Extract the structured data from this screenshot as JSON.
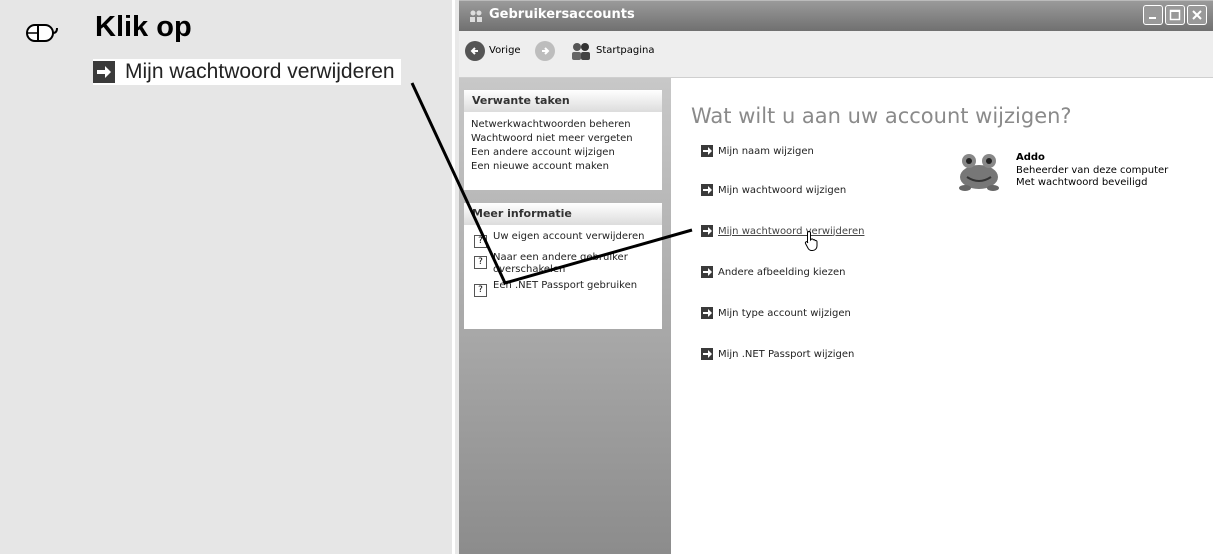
{
  "instruction": {
    "heading": "Klik op",
    "link_label": "Mijn wachtwoord verwijderen"
  },
  "window": {
    "title": "Gebruikersaccounts",
    "nav": {
      "back_label": "Vorige",
      "home_label": "Startpagina"
    }
  },
  "sidebar": {
    "related": {
      "heading": "Verwante taken",
      "items": [
        "Netwerkwachtwoorden beheren",
        "Wachtwoord niet meer vergeten",
        "Een andere account wijzigen",
        "Een nieuwe account maken"
      ]
    },
    "info": {
      "heading": "Meer informatie",
      "items": [
        "Uw eigen account verwijderen",
        "Naar een andere gebruiker overschakelen",
        "Een .NET Passport gebruiken"
      ]
    }
  },
  "main": {
    "title": "Wat wilt u aan uw account wijzigen?",
    "actions": [
      "Mijn naam wijzigen",
      "Mijn wachtwoord wijzigen",
      "Mijn wachtwoord verwijderen",
      "Andere afbeelding kiezen",
      "Mijn type account wijzigen",
      "Mijn .NET Passport wijzigen"
    ]
  },
  "user": {
    "name": "Addo",
    "role": "Beheerder van deze computer",
    "status": "Met wachtwoord beveiligd"
  },
  "colors": {
    "titlebar": "#808080",
    "sidebar": "#a8a8a8",
    "arrow_box": "#3a3a3a"
  }
}
